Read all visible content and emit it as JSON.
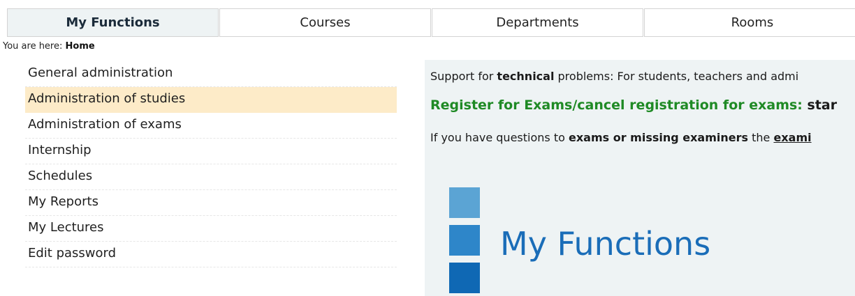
{
  "tabs": [
    {
      "label": "My Functions",
      "active": true
    },
    {
      "label": "Courses"
    },
    {
      "label": "Departments"
    },
    {
      "label": "Rooms"
    }
  ],
  "breadcrumb": {
    "prefix": "You are here:",
    "current": "Home"
  },
  "menu": {
    "items": [
      {
        "label": "General administration"
      },
      {
        "label": "Administration of studies",
        "selected": true
      },
      {
        "label": "Administration of exams"
      },
      {
        "label": "Internship"
      },
      {
        "label": "Schedules"
      },
      {
        "label": "My Reports"
      },
      {
        "label": "My Lectures"
      },
      {
        "label": "Edit password"
      }
    ]
  },
  "content": {
    "support": {
      "prefix": "Support for ",
      "bold": "technical",
      "suffix": " problems: For students, teachers and admi"
    },
    "register": {
      "text": "Register for Exams/cancel registration for exams:",
      "tail": " star"
    },
    "questions": {
      "prefix": "If you have questions to ",
      "bold": "exams or missing examiners",
      "middle": " the ",
      "link": "exami"
    },
    "heading": "My Functions"
  },
  "colors": {
    "accent_green": "#1f8a25",
    "heading_blue": "#1a6db8",
    "selected_bg": "#fdebc8",
    "panel_bg": "#eef3f4"
  }
}
